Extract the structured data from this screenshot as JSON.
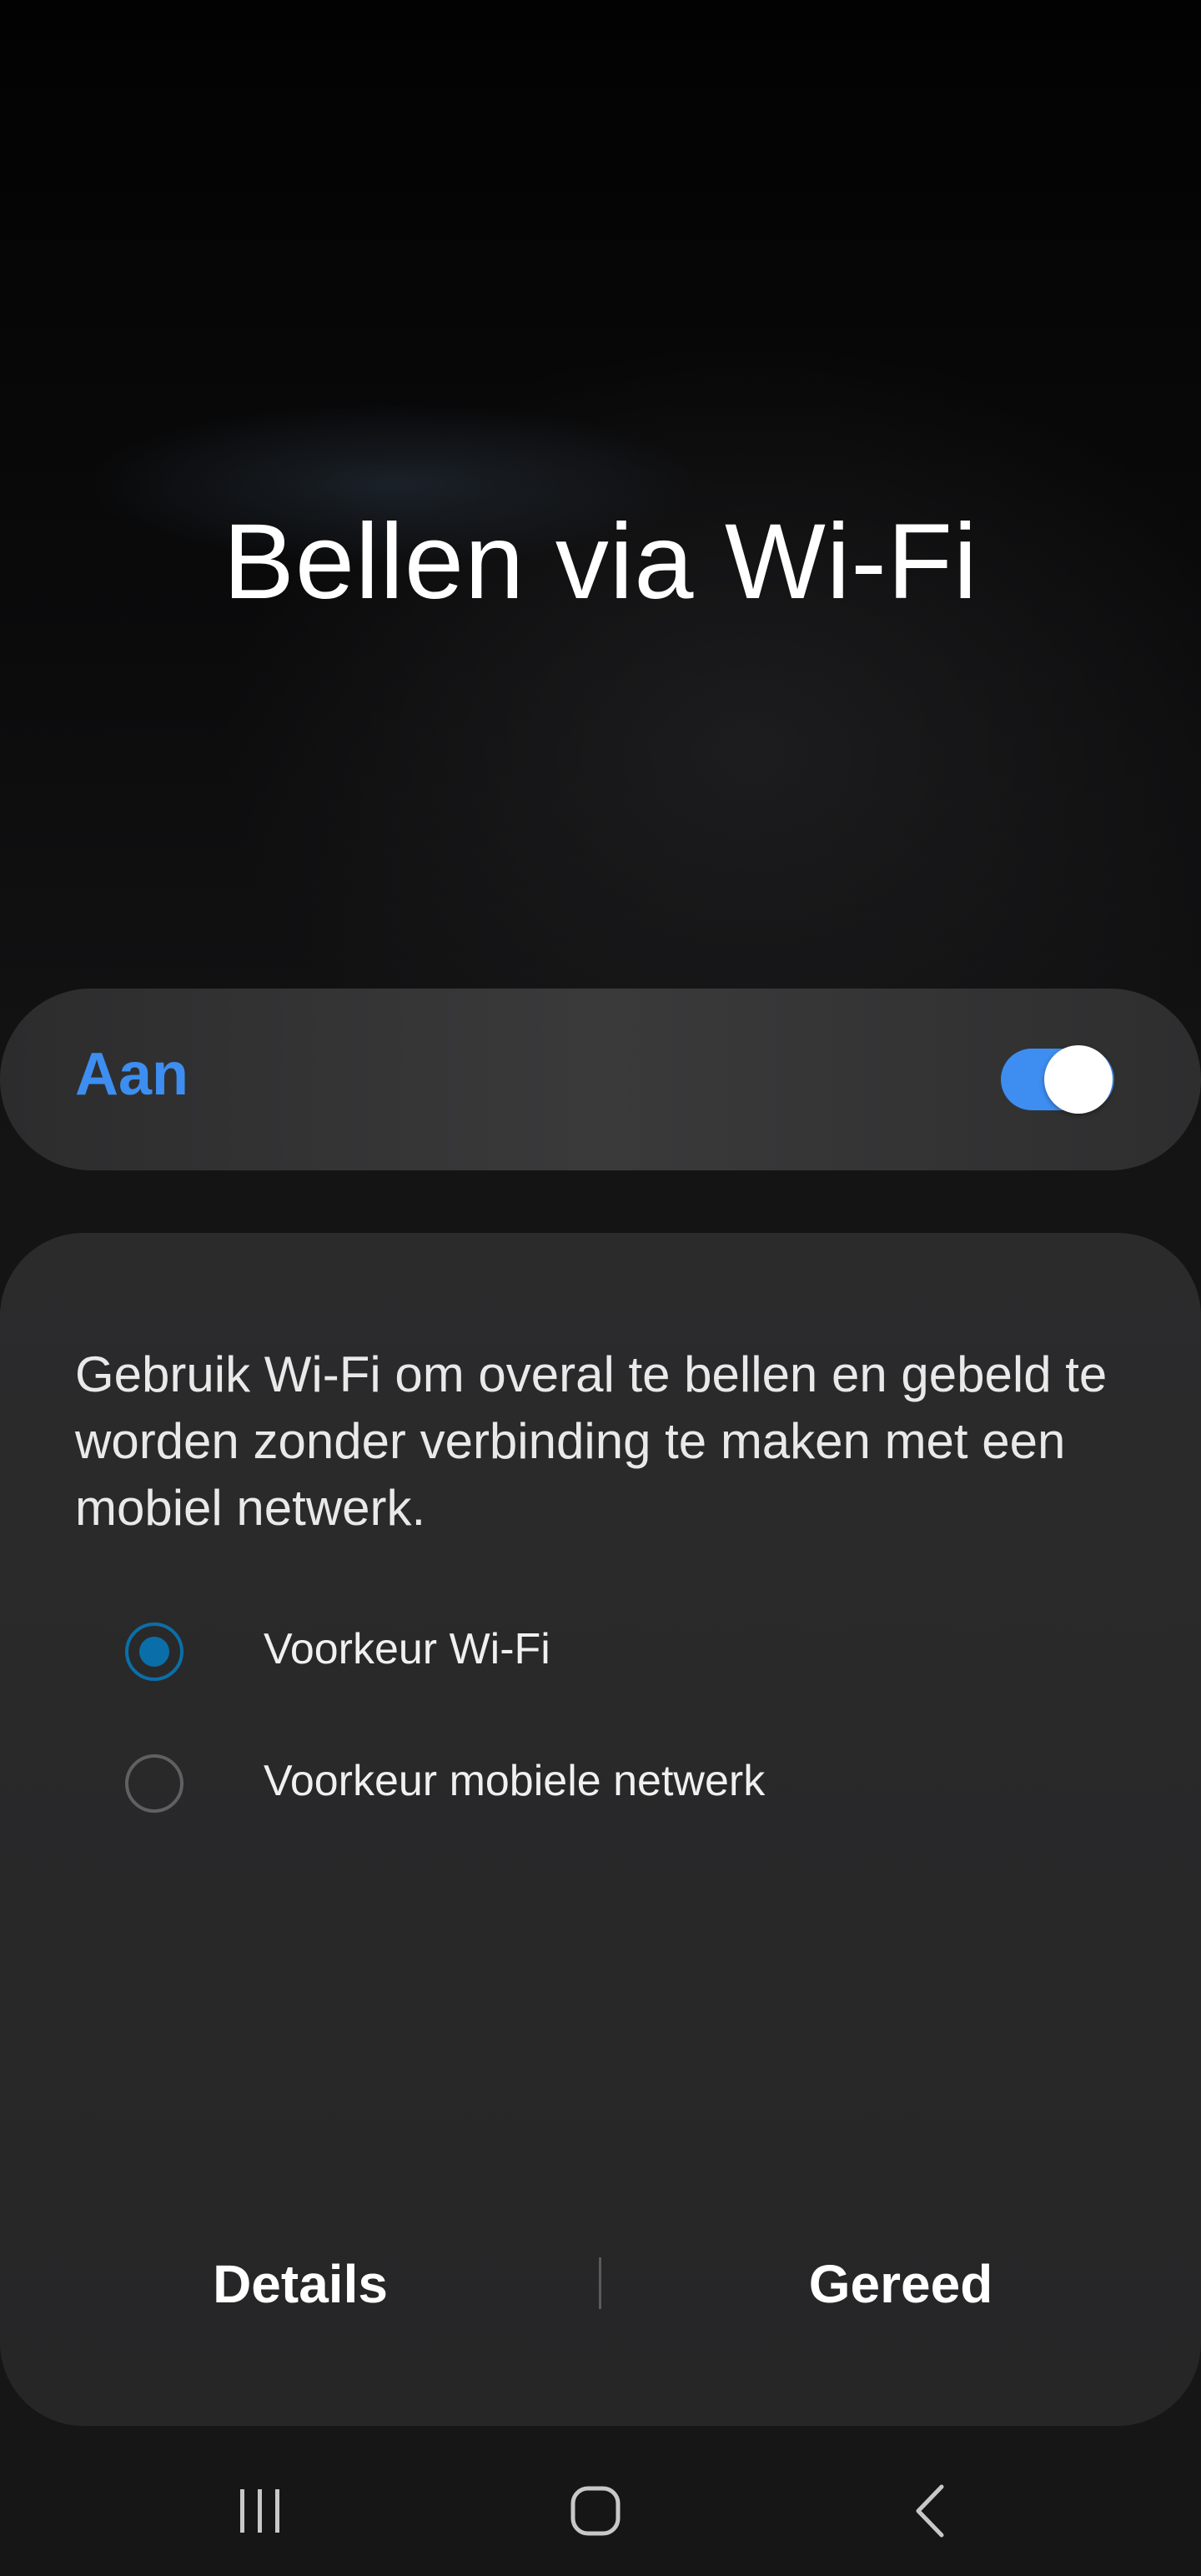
{
  "screen": {
    "title": "Bellen via Wi-Fi"
  },
  "master_switch": {
    "label": "Aan",
    "state": "on",
    "accent_color": "#3d8ef0"
  },
  "card": {
    "description": "Gebruik Wi-Fi om overal te bellen en gebeld te worden zonder verbinding te maken met een mobiel netwerk.",
    "options": [
      {
        "label": "Voorkeur Wi-Fi",
        "selected": true
      },
      {
        "label": "Voorkeur mobiele netwerk",
        "selected": false
      }
    ],
    "radio_selected_color": "#0a6fa8",
    "actions": {
      "details_label": "Details",
      "done_label": "Gereed"
    }
  },
  "navigation_bar": {
    "buttons": [
      {
        "icon": "recent-apps-icon"
      },
      {
        "icon": "home-icon"
      },
      {
        "icon": "back-icon"
      }
    ]
  }
}
